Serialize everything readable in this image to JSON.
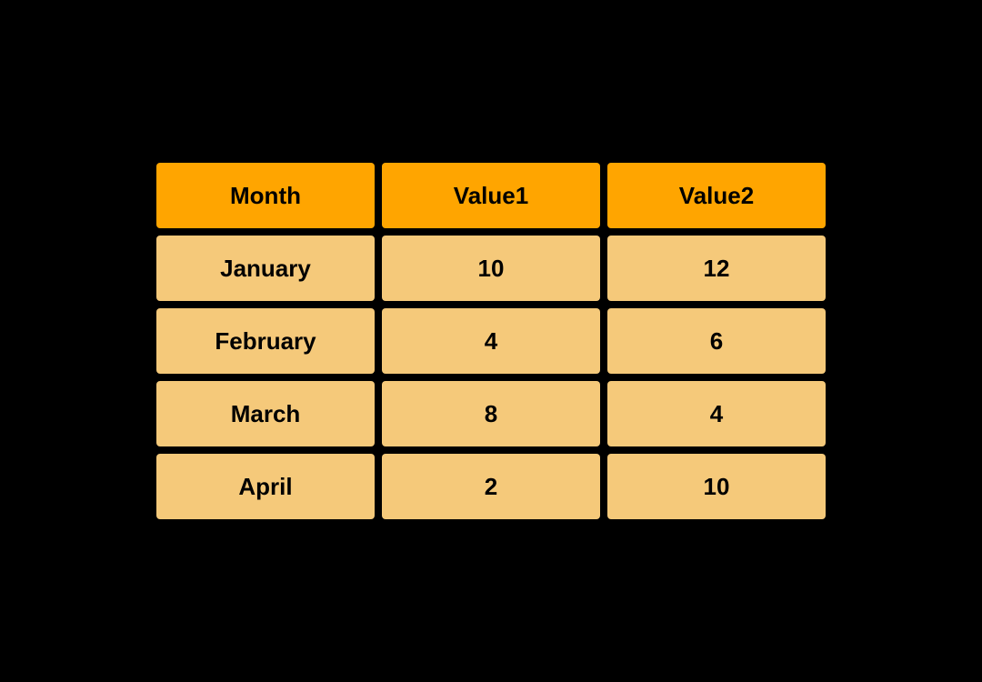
{
  "table": {
    "headers": [
      {
        "label": "Month",
        "key": "month-header"
      },
      {
        "label": "Value1",
        "key": "value1-header"
      },
      {
        "label": "Value2",
        "key": "value2-header"
      }
    ],
    "rows": [
      {
        "month": "January",
        "value1": "10",
        "value2": "12"
      },
      {
        "month": "February",
        "value1": "4",
        "value2": "6"
      },
      {
        "month": "March",
        "value1": "8",
        "value2": "4"
      },
      {
        "month": "April",
        "value1": "2",
        "value2": "10"
      }
    ]
  }
}
